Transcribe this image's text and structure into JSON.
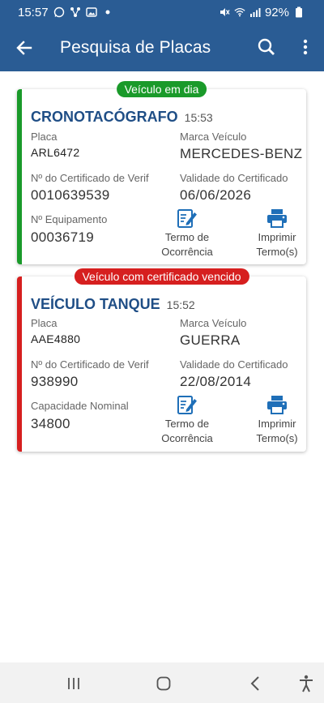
{
  "status_bar": {
    "time": "15:57",
    "battery": "92%",
    "left_icons": [
      "whatsapp-icon",
      "connection-icon",
      "image-icon",
      "dot-icon"
    ],
    "right_icons": [
      "mute-icon",
      "wifi-icon",
      "signal-icon",
      "battery-icon"
    ]
  },
  "app_bar": {
    "title": "Pesquisa de Placas",
    "color": "#2a5c94"
  },
  "records": [
    {
      "status": "Veículo em dia",
      "status_color": "#1a9a2a",
      "type": "CRONOTACÓGRAFO",
      "time": "15:53",
      "placa_label": "Placa",
      "placa": "ARL6472",
      "marca_label": "Marca Veículo",
      "marca": "MERCEDES-BENZ",
      "cert_label": "Nº do Certificado de Verif",
      "cert": "0010639539",
      "validade_label": "Validade do Certificado",
      "validade": "06/06/2026",
      "extra_label": "Nº Equipamento",
      "extra": "00036719",
      "termo_label_1": "Termo de",
      "termo_label_2": "Ocorrência",
      "imprimir_label_1": "Imprimir",
      "imprimir_label_2": "Termo(s)"
    },
    {
      "status": "Veículo com certificado vencido",
      "status_color": "#d61f1f",
      "type": "VEÍCULO TANQUE",
      "time": "15:52",
      "placa_label": "Placa",
      "placa": "AAE4880",
      "marca_label": "Marca Veículo",
      "marca": "GUERRA",
      "cert_label": "Nº do Certificado de Verif",
      "cert": "938990",
      "validade_label": "Validade do Certificado",
      "validade": "22/08/2014",
      "extra_label": "Capacidade Nominal",
      "extra": "34800",
      "termo_label_1": "Termo de",
      "termo_label_2": "Ocorrência",
      "imprimir_label_1": "Imprimir",
      "imprimir_label_2": "Termo(s)"
    }
  ],
  "nav_bar": {
    "icons": [
      "recent-apps-icon",
      "home-icon",
      "back-nav-icon",
      "accessibility-icon"
    ]
  }
}
